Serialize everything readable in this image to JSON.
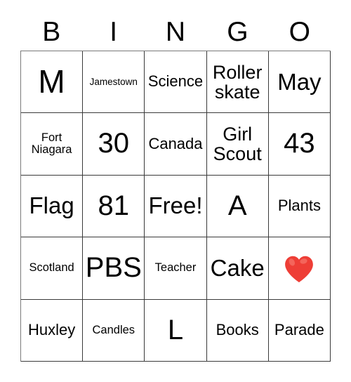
{
  "header": {
    "letters": [
      "B",
      "I",
      "N",
      "G",
      "O"
    ]
  },
  "colors": {
    "grid_line": "#3a3a3a",
    "text": "#000000",
    "background": "#ffffff",
    "heart_red": "#ee3e36",
    "heart_highlight": "#f4655b"
  },
  "grid": {
    "rows": [
      [
        {
          "text": "M",
          "size": "fs-hero"
        },
        {
          "text": "Jamestown",
          "size": "fs-xs"
        },
        {
          "text": "Science",
          "size": "fs-md"
        },
        {
          "text": "Roller skate",
          "size": "fs-lg"
        },
        {
          "text": "May",
          "size": "fs-xl"
        }
      ],
      [
        {
          "text": "Fort Niagara",
          "size": "fs-sm"
        },
        {
          "text": "30",
          "size": "fs-xxl"
        },
        {
          "text": "Canada",
          "size": "fs-md"
        },
        {
          "text": "Girl Scout",
          "size": "fs-lg"
        },
        {
          "text": "43",
          "size": "fs-xxl"
        }
      ],
      [
        {
          "text": "Flag",
          "size": "fs-xl"
        },
        {
          "text": "81",
          "size": "fs-xxl"
        },
        {
          "text": "Free!",
          "size": "fs-xl"
        },
        {
          "text": "A",
          "size": "fs-xxl"
        },
        {
          "text": "Plants",
          "size": "fs-md"
        }
      ],
      [
        {
          "text": "Scotland",
          "size": "fs-sm"
        },
        {
          "text": "PBS",
          "size": "fs-xxl"
        },
        {
          "text": "Teacher",
          "size": "fs-sm"
        },
        {
          "text": "Cake",
          "size": "fs-xl"
        },
        {
          "text": "heart-emoji",
          "size": "fs-xxl",
          "icon": "heart-icon"
        }
      ],
      [
        {
          "text": "Huxley",
          "size": "fs-md"
        },
        {
          "text": "Candles",
          "size": "fs-sm"
        },
        {
          "text": "L",
          "size": "fs-xxl"
        },
        {
          "text": "Books",
          "size": "fs-md"
        },
        {
          "text": "Parade",
          "size": "fs-md"
        }
      ]
    ]
  }
}
